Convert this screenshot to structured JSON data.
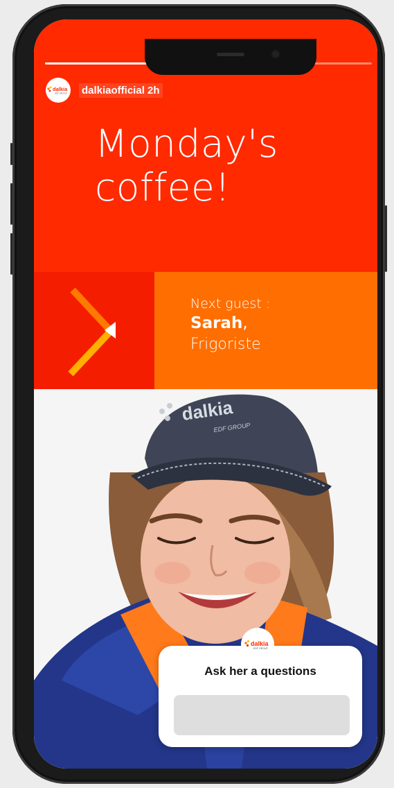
{
  "account": {
    "handle": "dalkiaofficial 2h",
    "logo_text": "dalkia",
    "logo_sub": "EDF GROUP"
  },
  "story": {
    "progress": [
      1,
      0,
      0
    ],
    "title_line1": "Monday's",
    "title_line2": "coffee!",
    "next_label": "Next guest :",
    "guest_name": "Sarah",
    "guest_comma": ",",
    "guest_role": "Frigoriste"
  },
  "photo": {
    "cap_text": "dalkia",
    "cap_sub": "EDF GROUP"
  },
  "question_sticker": {
    "title": "Ask her a questions",
    "logo_text": "dalkia",
    "logo_sub": "EDF GROUP",
    "input_value": ""
  },
  "colors": {
    "brand_red": "#ff2a00",
    "brand_orange": "#ff6e00",
    "chevron_orange": "#ff7a00",
    "chevron_yellow": "#ffc000"
  }
}
